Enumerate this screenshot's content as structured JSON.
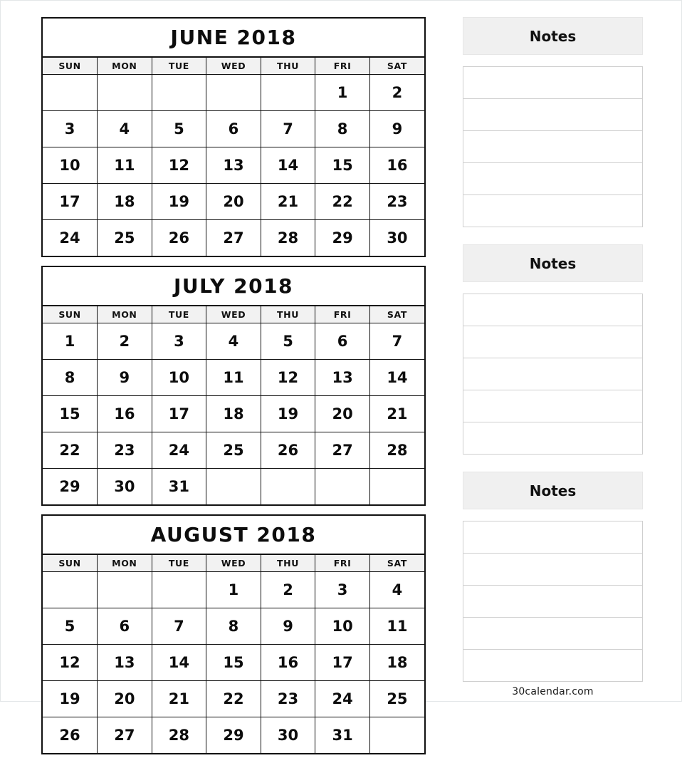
{
  "page": {
    "watermark": "30calendar.com",
    "colors": {
      "grid_line": "#111111",
      "weekday_header_bg": "#f2f2f2",
      "notes_header_bg": "#f0f0f0",
      "notes_line": "#cfcfcf",
      "text": "#0d0d0d"
    }
  },
  "weekdays": [
    "SUN",
    "MON",
    "TUE",
    "WED",
    "THU",
    "FRI",
    "SAT"
  ],
  "months": [
    {
      "title": "JUNE 2018",
      "weeks": [
        [
          "",
          "",
          "",
          "",
          "",
          "1",
          "2"
        ],
        [
          "3",
          "4",
          "5",
          "6",
          "7",
          "8",
          "9"
        ],
        [
          "10",
          "11",
          "12",
          "13",
          "14",
          "15",
          "16"
        ],
        [
          "17",
          "18",
          "19",
          "20",
          "21",
          "22",
          "23"
        ],
        [
          "24",
          "25",
          "26",
          "27",
          "28",
          "29",
          "30"
        ]
      ]
    },
    {
      "title": "JULY 2018",
      "weeks": [
        [
          "1",
          "2",
          "3",
          "4",
          "5",
          "6",
          "7"
        ],
        [
          "8",
          "9",
          "10",
          "11",
          "12",
          "13",
          "14"
        ],
        [
          "15",
          "16",
          "17",
          "18",
          "19",
          "20",
          "21"
        ],
        [
          "22",
          "23",
          "24",
          "25",
          "26",
          "27",
          "28"
        ],
        [
          "29",
          "30",
          "31",
          "",
          "",
          "",
          ""
        ]
      ]
    },
    {
      "title": "AUGUST 2018",
      "weeks": [
        [
          "",
          "",
          "",
          "1",
          "2",
          "3",
          "4"
        ],
        [
          "5",
          "6",
          "7",
          "8",
          "9",
          "10",
          "11"
        ],
        [
          "12",
          "13",
          "14",
          "15",
          "16",
          "17",
          "18"
        ],
        [
          "19",
          "20",
          "21",
          "22",
          "23",
          "24",
          "25"
        ],
        [
          "26",
          "27",
          "28",
          "29",
          "30",
          "31",
          ""
        ]
      ]
    }
  ],
  "notes_panels": [
    {
      "title": "Notes",
      "lines": [
        "",
        "",
        "",
        "",
        ""
      ]
    },
    {
      "title": "Notes",
      "lines": [
        "",
        "",
        "",
        "",
        ""
      ]
    },
    {
      "title": "Notes",
      "lines": [
        "",
        "",
        "",
        "",
        ""
      ]
    }
  ]
}
